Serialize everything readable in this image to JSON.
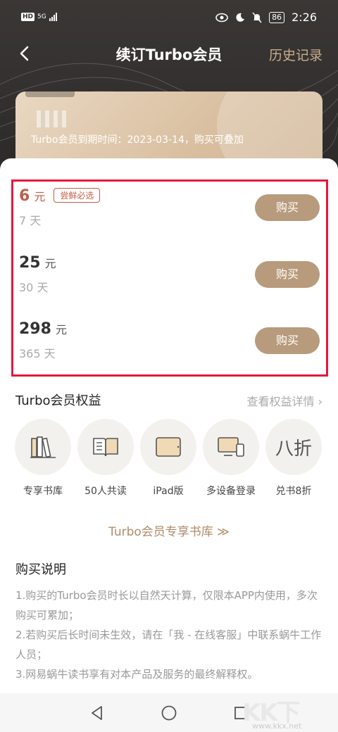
{
  "status_bar": {
    "hd": "HD",
    "signal": "5G",
    "battery": "86",
    "time": "2:26"
  },
  "nav": {
    "title": "续订Turbo会员",
    "history_label": "历史记录"
  },
  "vip_card": {
    "expire_text": "Turbo会员到期时间：2023-03-14，购买可叠加"
  },
  "plans": [
    {
      "price": "6",
      "unit": "元",
      "tag": "尝鲜必选",
      "days": "7 天",
      "button": "购买"
    },
    {
      "price": "25",
      "unit": "元",
      "days": "30 天",
      "button": "购买"
    },
    {
      "price": "298",
      "unit": "元",
      "days": "365 天",
      "button": "购买"
    }
  ],
  "benefits": {
    "title": "Turbo会员权益",
    "more": "查看权益详情",
    "items": [
      {
        "label": "专享书库",
        "icon": "books-icon"
      },
      {
        "label": "50人共读",
        "icon": "open-book-icon"
      },
      {
        "label": "iPad版",
        "icon": "ipad-icon"
      },
      {
        "label": "多设备登录",
        "icon": "devices-icon"
      },
      {
        "label": "兑书8折",
        "icon": "discount-icon",
        "glyph": "八折"
      }
    ]
  },
  "library_link": "Turbo会员专享书库 ≫",
  "purchase_notes": {
    "title": "购买说明",
    "lines": [
      "1.购买的Turbo会员时长以自然天计算，仅限本APP内使用，多次购买可累加；",
      "2.若购买后长时间未生效，请在「我 - 在线客服」中联系蜗牛工作人员；",
      "3.网易蜗牛读书享有对本产品及服务的最终解释权。"
    ]
  },
  "watermark": {
    "text": "KK下载",
    "url": "www.kkx.net"
  },
  "colors": {
    "accent": "#b89b7c",
    "highlight_red": "#e8163c",
    "price_hot": "#c25e4a",
    "link": "#b08c6a"
  }
}
